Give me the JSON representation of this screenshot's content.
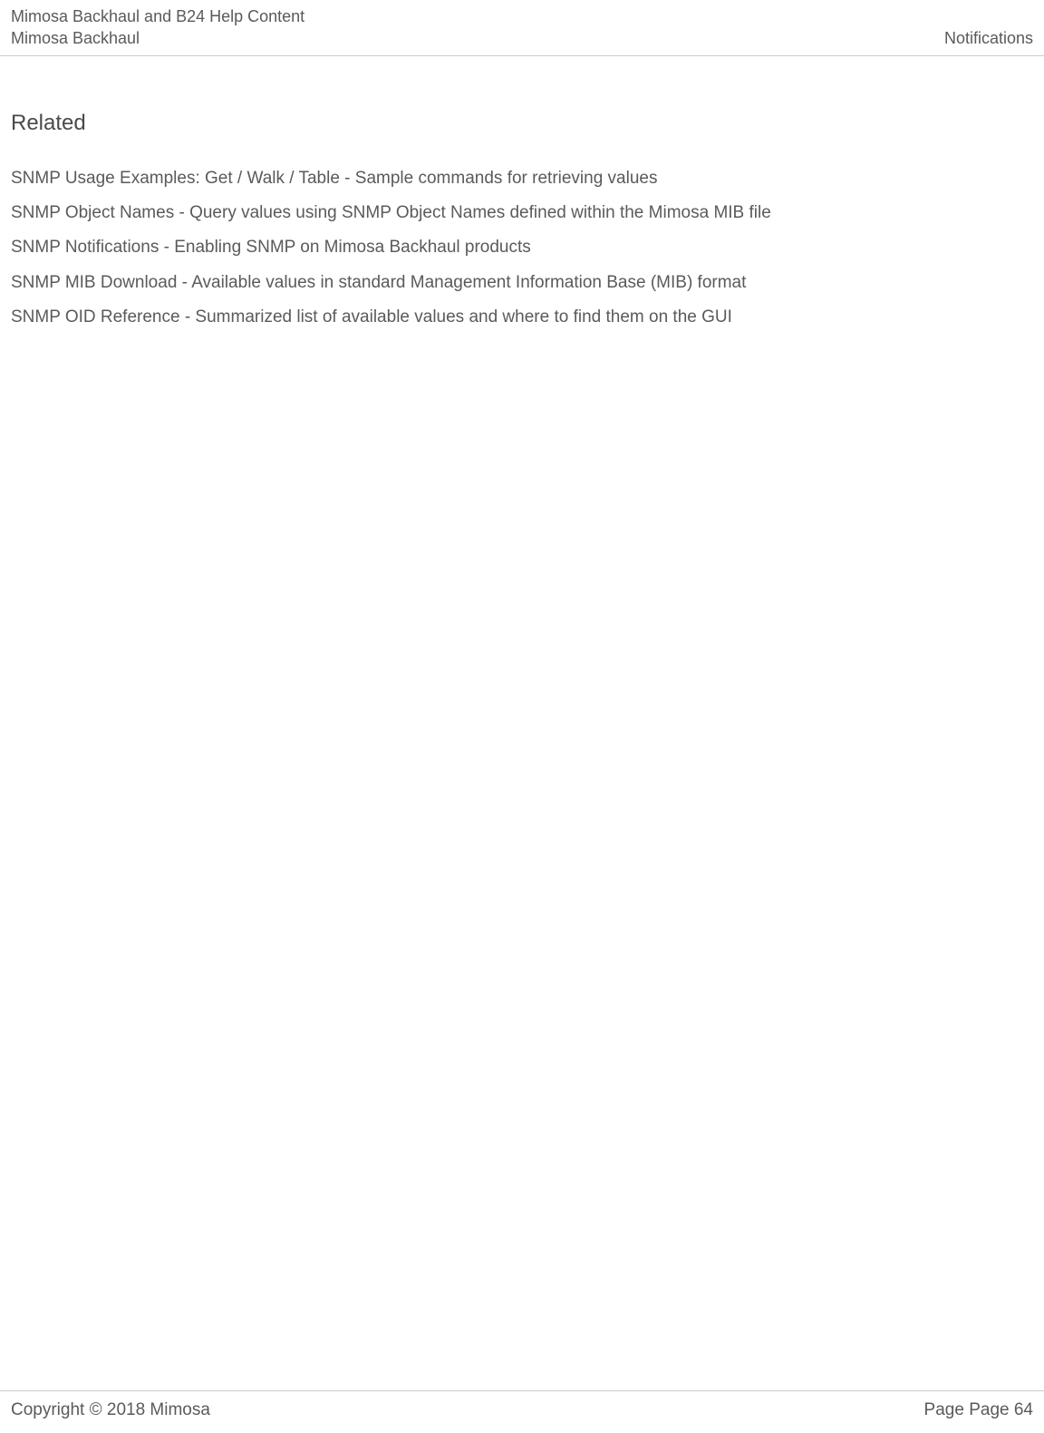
{
  "header": {
    "title": "Mimosa Backhaul and B24 Help Content",
    "subtitle": "Mimosa Backhaul",
    "right": "Notifications"
  },
  "section": {
    "heading": "Related",
    "items": [
      "SNMP Usage Examples: Get / Walk / Table - Sample commands for retrieving values",
      "SNMP Object Names - Query values using SNMP Object Names defined within the Mimosa MIB file",
      "SNMP Notifications - Enabling SNMP on Mimosa Backhaul products",
      "SNMP MIB Download - Available values in standard Management Information Base (MIB) format",
      "SNMP OID Reference - Summarized list of available values and where to find them on the GUI"
    ]
  },
  "footer": {
    "copyright": "Copyright © 2018 Mimosa",
    "page": "Page Page 64"
  }
}
